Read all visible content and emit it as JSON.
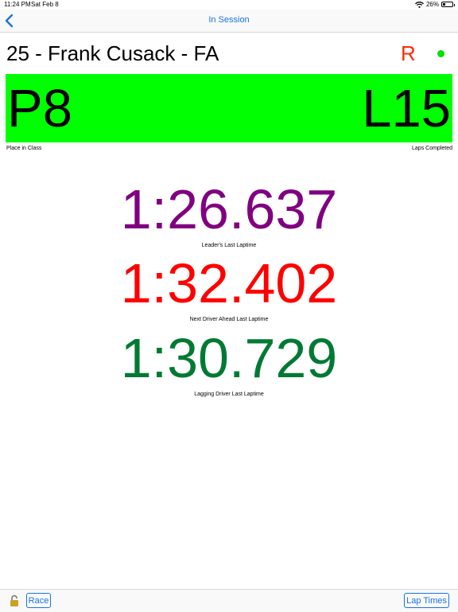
{
  "status_bar": {
    "time": "11:24 PM",
    "date": "Sat Feb 8",
    "battery": "26%",
    "battery_level": 0.26
  },
  "nav": {
    "title": "In Session"
  },
  "driver": {
    "name": "25 - Frank Cusack - FA",
    "flag": "R"
  },
  "banner": {
    "place": "P8",
    "laps": "L15",
    "place_caption": "Place in Class",
    "laps_caption": "Laps Completed",
    "color": "#00ff00"
  },
  "laptimes": [
    {
      "time": "1:26.637",
      "caption": "Leader's Last Laptime",
      "color": "#800080"
    },
    {
      "time": "1:32.402",
      "caption": "Next Driver Ahead Last Laptime",
      "color": "#ff0000"
    },
    {
      "time": "1:30.729",
      "caption": "Lagging Driver Last Laptime",
      "color": "#007a33"
    }
  ],
  "toolbar": {
    "race_label": "Race",
    "laptimes_label": "Lap Times"
  }
}
